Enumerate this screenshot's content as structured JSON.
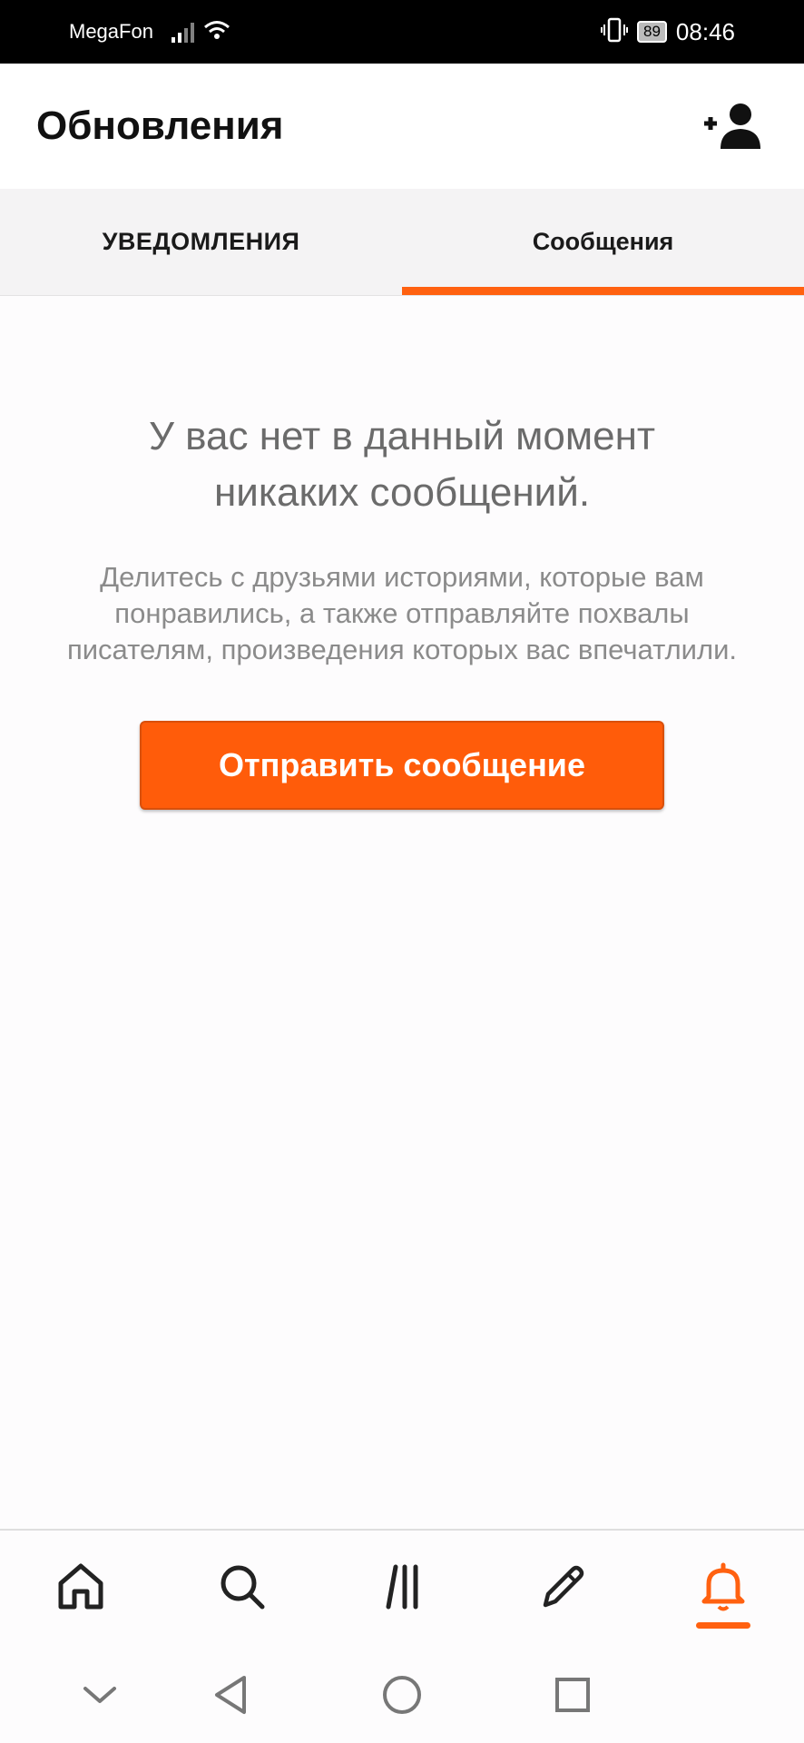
{
  "status_bar": {
    "carrier": "MegaFon",
    "battery": "89",
    "time": "08:46"
  },
  "header": {
    "title": "Обновления",
    "add_user_icon": "add-person-icon"
  },
  "tabs": [
    {
      "label": "УВЕДОМЛЕНИЯ",
      "active": false
    },
    {
      "label": "Сообщения",
      "active": true
    }
  ],
  "empty_state": {
    "headline": "У вас нет в данный момент никаких сообщений.",
    "description": "Делитесь с друзьями историями, которые вам понравились, а также отправляйте похвалы писателям, произведения которых вас впечатлили.",
    "button_label": "Отправить сообщение"
  },
  "bottom_nav": [
    {
      "icon": "home-icon",
      "active": false
    },
    {
      "icon": "search-icon",
      "active": false
    },
    {
      "icon": "library-icon",
      "active": false
    },
    {
      "icon": "pencil-icon",
      "active": false
    },
    {
      "icon": "bell-icon",
      "active": true
    }
  ],
  "colors": {
    "accent": "#ff6110",
    "button": "#ff5c0a",
    "headline_text": "#6b6b6b",
    "body_text": "#8b8b8b"
  }
}
